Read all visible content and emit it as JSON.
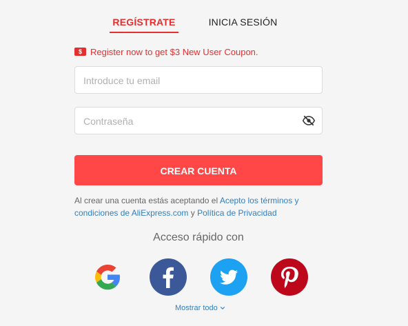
{
  "tabs": {
    "register": "REGÍSTRATE",
    "login": "INICIA SESIÓN"
  },
  "coupon": {
    "icon": "$",
    "text": "Register now to get $3 New User Coupon."
  },
  "form": {
    "email_placeholder": "Introduce tu email",
    "password_placeholder": "Contraseña",
    "submit_label": "CREAR CUENTA"
  },
  "terms": {
    "prefix": "Al crear una cuenta estás aceptando el ",
    "link1": "Acepto los términos y condiciones de AliExpress.com",
    "middle": " y ",
    "link2": "Política de Privacidad"
  },
  "quick_access": {
    "title": "Acceso rápido con",
    "providers": [
      "google",
      "facebook",
      "twitter",
      "pinterest"
    ],
    "show_all": "Mostrar todo"
  },
  "colors": {
    "accent": "#e62e2e",
    "button": "#ff4747",
    "link": "#2e7fc2",
    "facebook": "#3b5998",
    "twitter": "#1da1f2",
    "pinterest": "#bd081c"
  }
}
